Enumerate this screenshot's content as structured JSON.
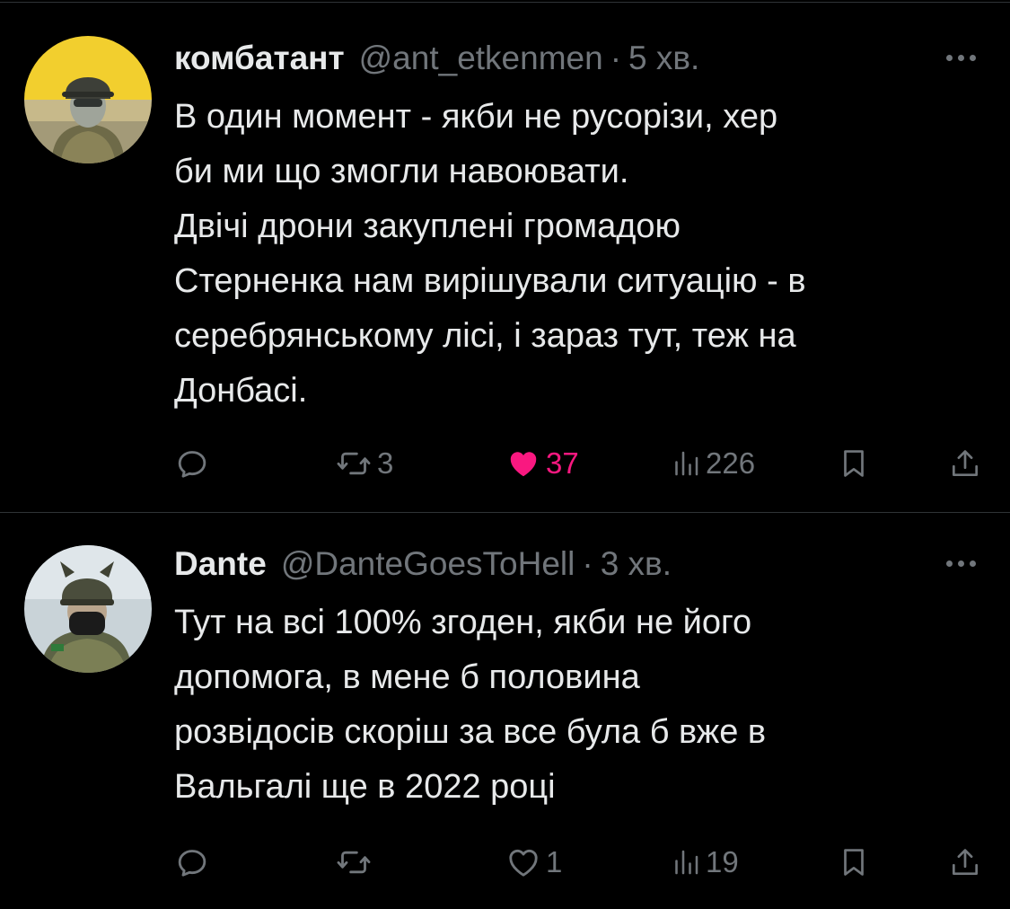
{
  "tweets": [
    {
      "display_name": "комбатант",
      "handle": "@ant_etkenmen",
      "separator": "·",
      "time": "5 хв.",
      "text": "В один момент - якби не русорізи, хер\nби ми що змогли навоювати.\nДвічі дрони закуплені громадою\nСтерненка нам вирішували ситуацію - в\nсеребрянському лісі, і зараз тут, теж на\nДонбасі.",
      "reposts": "3",
      "likes": "37",
      "views": "226",
      "liked": true
    },
    {
      "display_name": "Dante",
      "handle": "@DanteGoesToHell",
      "separator": "·",
      "time": "3 хв.",
      "text": "Тут на всі 100% згоден, якби не його\nдопомога, в мене б половина\nрозвідосів скоріш за все була б вже в\nВальгалі ще в 2022 році",
      "reposts": "",
      "likes": "1",
      "views": "19",
      "liked": false
    }
  ],
  "icons": {
    "reply": "reply-icon",
    "repost": "repost-icon",
    "like": "heart-icon",
    "views": "views-icon",
    "bookmark": "bookmark-icon",
    "share": "share-icon",
    "more": "more-icon"
  },
  "colors": {
    "background": "#000000",
    "text": "#e7e9ea",
    "secondary": "#71767b",
    "like_active": "#f91880",
    "divider": "#2f3336"
  }
}
